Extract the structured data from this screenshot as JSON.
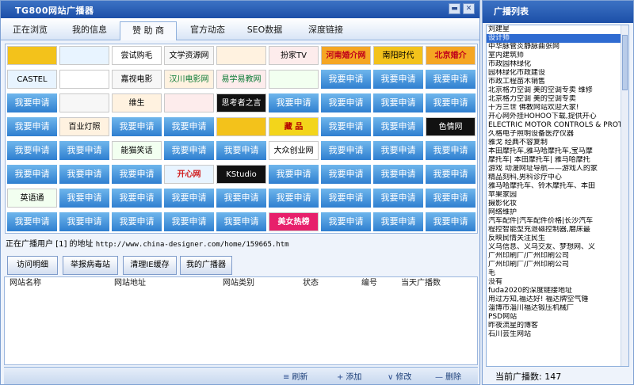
{
  "app": {
    "title": "TG800网站广播器",
    "min_icon": "▬",
    "close_icon": "✕"
  },
  "tabs": [
    {
      "label": "正在浏览"
    },
    {
      "label": "我的信息"
    },
    {
      "label": "赞 助 商"
    },
    {
      "label": "官方动态"
    },
    {
      "label": "SEO数据"
    },
    {
      "label": "深度链接"
    }
  ],
  "active_tab": 2,
  "banners": {
    "apply_label": "我要申请",
    "rows": [
      [
        "img",
        "img",
        "尝试购毛",
        "文学资源网",
        "img",
        "扮家TV",
        "河南婚介网",
        "南阳时代",
        "北京婚介"
      ],
      [
        "CASTEL",
        "img",
        "嘉视电影",
        "汉川电影网",
        "易学易教网",
        "img",
        "我要申请",
        "我要申请",
        "我要申请"
      ],
      [
        "我要申请",
        "img",
        "维生",
        "img",
        "思考者之言",
        "我要申请",
        "我要申请",
        "我要申请",
        "我要申请"
      ],
      [
        "我要申请",
        "百业灯照",
        "我要申请",
        "我要申请",
        "img",
        "藏 品",
        "我要申请",
        "我要申请",
        "色情网"
      ],
      [
        "我要申请",
        "我要申请",
        "能猫笑话",
        "我要申请",
        "我要申请",
        "大众创业网",
        "我要申请",
        "我要申请",
        "我要申请"
      ],
      [
        "我要申请",
        "我要申请",
        "我要申请",
        "开心网",
        "KStudio",
        "我要申请",
        "我要申请",
        "我要申请",
        "我要申请"
      ],
      [
        "英语通",
        "我要申请",
        "我要申请",
        "我要申请",
        "我要申请",
        "我要申请",
        "我要申请",
        "我要申请",
        "我要申请"
      ],
      [
        "我要申请",
        "我要申请",
        "我要申请",
        "我要申请",
        "我要申请",
        "美女热榜",
        "我要申请",
        "我要申请",
        "我要申请"
      ]
    ]
  },
  "status": {
    "prefix": "正在广播用户 [1] 的地址",
    "url": "http://www.china-designer.com/home/159665.htm"
  },
  "actions": [
    {
      "label": "访问明细"
    },
    {
      "label": "举报病毒站"
    },
    {
      "label": "清理IE缓存"
    },
    {
      "label": "我的广播器"
    }
  ],
  "table": {
    "columns": [
      "网站名称",
      "网站地址",
      "网站类别",
      "状态",
      "编号",
      "当天广播数"
    ]
  },
  "toolbar": [
    {
      "icon": "≡",
      "label": "刷新"
    },
    {
      "icon": "+",
      "label": "添加"
    },
    {
      "icon": "∨",
      "label": "修改"
    },
    {
      "icon": "—",
      "label": "删除"
    }
  ],
  "side": {
    "title": "广播列表",
    "items": [
      "刘建星",
      "设计师",
      "中华脉管炎静脉曲张网",
      "室内建筑师",
      "市政园林绿化",
      "园林绿化市政建设",
      "市政工程苗木销售",
      "北京格力空调 美的空调专卖 维修",
      "北京格力空调 美的空调专卖",
      "十方三世 佛教网站欢迎大家!",
      "开心网外挂HOHOO下载,提供开心",
      "ELECTRIC MOTOR CONTROLS & PROT",
      "久格电子照明设备医疗仪器",
      "雅戈 经典不容复制",
      "本田摩托车,雅马哈摩托车,宝马摩",
      "摩托车| 本田摩托车| 雅马哈摩托",
      "游戏 动漫网址导航——游戏人的家",
      "精品刻科,男科诊疗中心",
      "雅马哈摩托车、铃木摩托车、本田",
      "苹果家园",
      "摄影化妆",
      "网络维护",
      "汽车配件|汽车配件价格|长沙汽车",
      "程控智能型充退磁控制器,磨床最",
      "反映民情关注民生",
      "义乌信息、义乌交友、梦想网、义",
      "广州印刷厂/广州印刷公司",
      "广州印刷厂/广州印刷公司",
      "毛",
      "没有",
      "fuda2020的深度链接地址",
      "用过方知,福达好! 福达牌空气锤",
      "淄博市淄川福达锻压机械厂",
      "PSD网站",
      "昨夜流星的博客",
      "石川芸生网站"
    ],
    "selected": 1,
    "current_label": "当前广播数:",
    "current_count": "147"
  },
  "colors": {
    "title_bar": "#1c4fa8",
    "apply_banner": "#2f7fd0",
    "selected_item": "#2f6bd1"
  }
}
